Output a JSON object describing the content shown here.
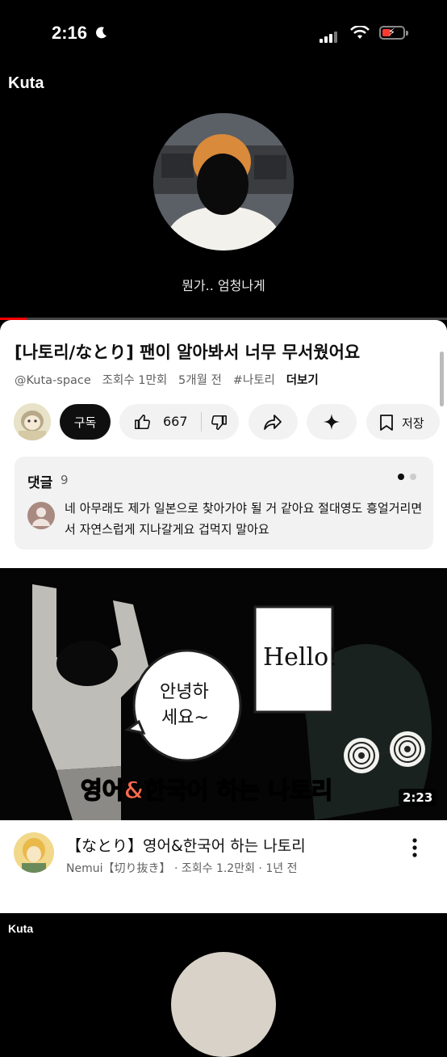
{
  "status_bar": {
    "time": "2:16"
  },
  "player": {
    "channel_title": "Kuta",
    "caption": "뭔가.. 엄청나게",
    "progress": 0.06
  },
  "video": {
    "title": "[나토리/なとり] 팬이 알아봐서 너무 무서웠어요",
    "channel_handle": "@Kuta-space",
    "views": "조회수 1만회",
    "age": "5개월 전",
    "hashtag": "#나토리",
    "more_label": "더보기"
  },
  "actions": {
    "subscribe_label": "구독",
    "like_count": "667",
    "save_label": "저장"
  },
  "comments": {
    "header": "댓글",
    "count": "9",
    "top_comment": "네 아무래도 제가 일본으로 찾아가야 될 거 같아요 절대영도 흥얼거리면서 자연스럽게 지나갈게요 겁먹지 말아요"
  },
  "thumbnail": {
    "bubble_text_1": "안녕하",
    "bubble_text_2": "세요~",
    "hello_text": "Hello!",
    "overlay_title": "영어&한국어 하는 나토리",
    "duration": "2:23"
  },
  "next_video": {
    "title": "【なとり】영어&한국어 하는 나토리",
    "channel": "Nemui【切り抜き】",
    "views": "조회수 1.2만회",
    "age": "1년 전"
  },
  "next_short": {
    "channel_title": "Kuta"
  },
  "colors": {
    "accent": "#ff0000",
    "text_primary": "#0f0f0f",
    "text_secondary": "#606060",
    "chip_bg": "#f2f2f2",
    "overlay_title": "#ff6a4d"
  }
}
